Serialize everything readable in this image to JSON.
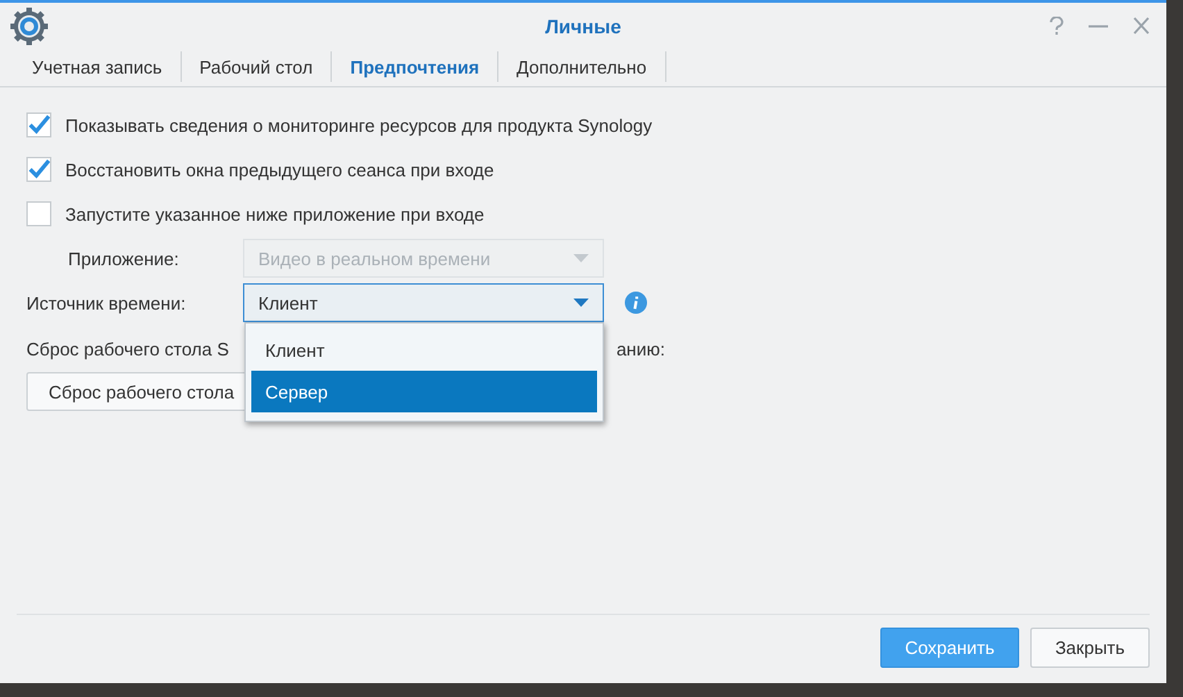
{
  "window": {
    "title": "Личные"
  },
  "tabs": [
    {
      "label": "Учетная запись",
      "selected": false
    },
    {
      "label": "Рабочий стол",
      "selected": false
    },
    {
      "label": "Предпочтения",
      "selected": true
    },
    {
      "label": "Дополнительно",
      "selected": false
    }
  ],
  "options": [
    {
      "label": "Показывать сведения о мониторинге ресурсов для продукта Synology",
      "checked": true
    },
    {
      "label": "Восстановить окна предыдущего сеанса при входе",
      "checked": true
    },
    {
      "label": "Запустите указанное ниже приложение при входе",
      "checked": false
    }
  ],
  "application": {
    "label": "Приложение:",
    "value": "Видео в реальном времени",
    "disabled": true
  },
  "time_source": {
    "label": "Источник времени:",
    "value": "Клиент",
    "disabled": false,
    "expanded": true,
    "options": [
      {
        "label": "Клиент",
        "highlighted": false
      },
      {
        "label": "Сервер",
        "highlighted": true
      }
    ]
  },
  "reset": {
    "label_start": "Сброс рабочего стола S",
    "label_end": "анию:",
    "button": "Сброс рабочего стола"
  },
  "footer_buttons": [
    {
      "label": "Сохранить",
      "kind": "primary"
    },
    {
      "label": "Закрыть",
      "kind": "secondary"
    }
  ]
}
